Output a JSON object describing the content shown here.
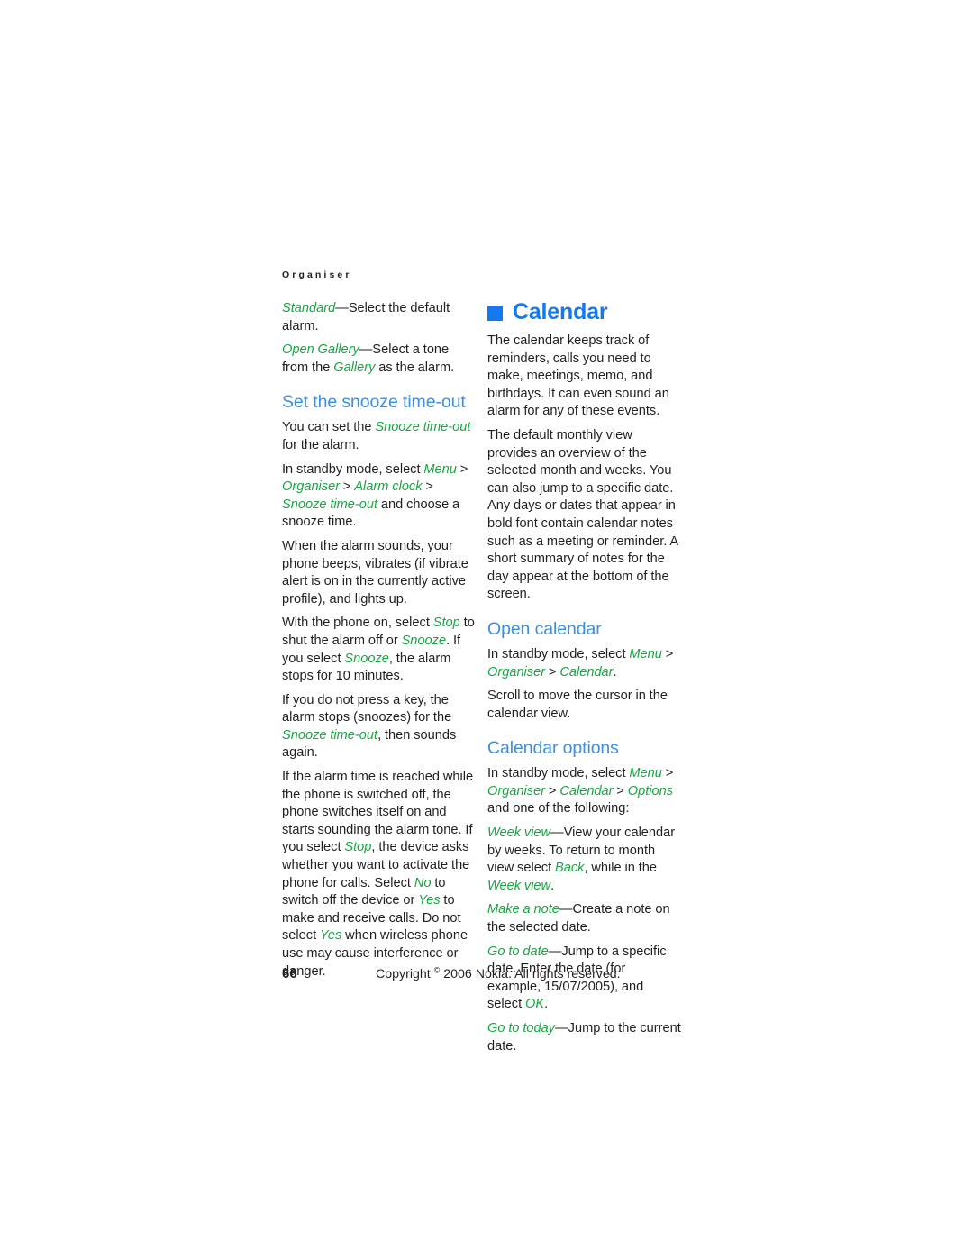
{
  "document": {
    "running_header": "Organiser",
    "page_number": "66",
    "copyright_pre": "Copyright ",
    "copyright_symbol": "©",
    "copyright_post": " 2006 Nokia. All rights reserved."
  },
  "colors": {
    "chapter_heading": "#1478f0",
    "section_heading": "#3f8fdc",
    "ui_term": "#19a543",
    "body_text": "#231f20",
    "page_background": "#ffffff"
  },
  "left_column": {
    "alarm_options": [
      {
        "term": "Standard",
        "rest": "—Select the default alarm."
      },
      {
        "term": "Open Gallery",
        "rest_a": "—Select a tone from the ",
        "term_b": "Gallery",
        "rest_b": " as the alarm."
      }
    ],
    "snooze_section": {
      "heading": "Set the snooze time-out",
      "p1_a": "You can set the ",
      "p1_term": "Snooze time-out",
      "p1_b": " for the alarm.",
      "p2_a": "In standby mode, select ",
      "p2_menu": "Menu",
      "p2_sep1": " > ",
      "p2_organiser": "Organiser",
      "p2_sep2": " > ",
      "p2_alarmclock": "Alarm clock",
      "p2_sep3": " > ",
      "p2_snoozetimeout": "Snooze time-out",
      "p2_b": " and choose a snooze time.",
      "p3": "When the alarm sounds, your phone beeps, vibrates (if vibrate alert is on in the currently active profile), and lights up.",
      "p4_a": "With the phone on, select ",
      "p4_stop": "Stop",
      "p4_b": " to shut the alarm off or ",
      "p4_snooze1": "Snooze",
      "p4_c": ". If you select ",
      "p4_snooze2": "Snooze",
      "p4_d": ", the alarm stops for 10 minutes.",
      "p5_a": "If you do not press a key, the alarm stops (snoozes) for the ",
      "p5_term": "Snooze time-out",
      "p5_b": ", then sounds again.",
      "p6_a": "If the alarm time is reached while the phone is switched off, the phone switches itself on and starts sounding the alarm tone. If you select ",
      "p6_stop": "Stop",
      "p6_b": ", the device asks whether you want to activate the phone for calls. Select ",
      "p6_no": "No",
      "p6_c": " to switch off the device or ",
      "p6_yes1": "Yes",
      "p6_d": " to make and receive calls. Do not select ",
      "p6_yes2": "Yes",
      "p6_e": " when wireless phone use may cause interference or danger."
    }
  },
  "right_column": {
    "chapter": {
      "bullet_icon": "square-bullet-icon",
      "title": "Calendar",
      "p1": "The calendar keeps track of reminders, calls you need to make, meetings, memo, and birthdays. It can even sound an alarm for any of these events.",
      "p2": "The default monthly view provides an overview of the selected month and weeks. You can also jump to a specific date. Any days or dates that appear in bold font contain calendar notes such as a meeting or reminder. A short summary of notes for the day appear at the bottom of the screen."
    },
    "open_calendar": {
      "heading": "Open calendar",
      "p1_a": "In standby mode, select ",
      "p1_menu": "Menu",
      "p1_sep1": " > ",
      "p1_organiser": "Organiser",
      "p1_sep2": " > ",
      "p1_calendar": "Calendar",
      "p1_b": ".",
      "p2": "Scroll to move the cursor in the calendar view."
    },
    "calendar_options": {
      "heading": "Calendar options",
      "intro_a": "In standby mode, select ",
      "intro_menu": "Menu",
      "intro_sep1": " > ",
      "intro_organiser": "Organiser",
      "intro_sep2": " > ",
      "intro_calendar": "Calendar",
      "intro_sep3": " > ",
      "intro_options": "Options",
      "intro_b": " and one of the following:",
      "items": [
        {
          "term": "Week view",
          "text_a": "—View your calendar by weeks. To return to month view select ",
          "term_b": "Back",
          "text_b": ", while in the ",
          "term_c": "Week view",
          "text_c": "."
        },
        {
          "term": "Make a note",
          "text_a": "—Create a note on the selected date."
        },
        {
          "term": "Go to date",
          "text_a": "—Jump to a specific date. Enter the date (for example, 15/07/2005), and select ",
          "term_b": "OK",
          "text_b": "."
        },
        {
          "term": "Go to today",
          "text_a": "—Jump to the current date."
        }
      ]
    }
  }
}
